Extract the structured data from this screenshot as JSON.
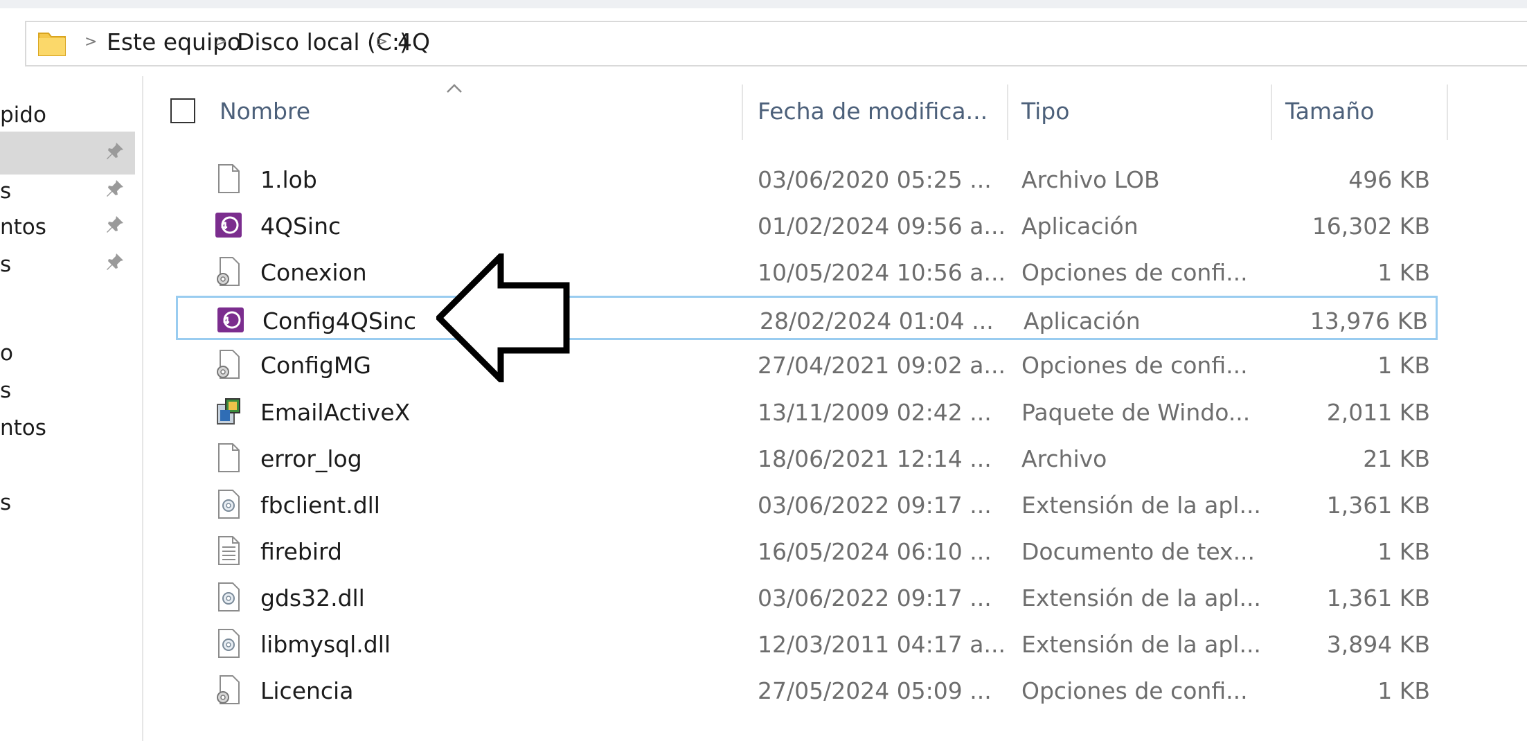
{
  "breadcrumb": [
    "Este equipo",
    "Disco local (C:)",
    "4Q"
  ],
  "nav": {
    "items": [
      {
        "label": "pido",
        "pinned": false,
        "selected": false
      },
      {
        "label": "",
        "pinned": true,
        "selected": true
      },
      {
        "label": "s",
        "pinned": true,
        "selected": false
      },
      {
        "label": "ntos",
        "pinned": true,
        "selected": false
      },
      {
        "label": "s",
        "pinned": true,
        "selected": false
      },
      {
        "label": "o",
        "pinned": false,
        "selected": false
      },
      {
        "label": "s",
        "pinned": false,
        "selected": false
      },
      {
        "label": "ntos",
        "pinned": false,
        "selected": false
      },
      {
        "label": "",
        "pinned": false,
        "selected": false
      },
      {
        "label": "s",
        "pinned": false,
        "selected": false
      }
    ]
  },
  "columns": {
    "name": "Nombre",
    "date": "Fecha de modifica...",
    "type": "Tipo",
    "size": "Tamaño"
  },
  "files": [
    {
      "name": "1.lob",
      "date": "03/06/2020 05:25 ...",
      "type": "Archivo LOB",
      "size": "496 KB",
      "icon": "blank-file-icon"
    },
    {
      "name": "4QSinc",
      "date": "01/02/2024 09:56 a...",
      "type": "Aplicación",
      "size": "16,302 KB",
      "icon": "4q-app-icon"
    },
    {
      "name": "Conexion",
      "date": "10/05/2024 10:56 a...",
      "type": "Opciones de confi...",
      "size": "1 KB",
      "icon": "config-file-icon"
    },
    {
      "name": "Config4QSinc",
      "date": "28/02/2024 01:04 ...",
      "type": "Aplicación",
      "size": "13,976 KB",
      "icon": "4q-app-icon"
    },
    {
      "name": "ConfigMG",
      "date": "27/04/2021 09:02 a...",
      "type": "Opciones de confi...",
      "size": "1 KB",
      "icon": "config-file-icon"
    },
    {
      "name": "EmailActiveX",
      "date": "13/11/2009 02:42 ...",
      "type": "Paquete de Windo...",
      "size": "2,011 KB",
      "icon": "installer-package-icon"
    },
    {
      "name": "error_log",
      "date": "18/06/2021 12:14 ...",
      "type": "Archivo",
      "size": "21 KB",
      "icon": "blank-file-icon"
    },
    {
      "name": "fbclient.dll",
      "date": "03/06/2022 09:17 ...",
      "type": "Extensión de la apl...",
      "size": "1,361 KB",
      "icon": "dll-file-icon"
    },
    {
      "name": "firebird",
      "date": "16/05/2024 06:10 ...",
      "type": "Documento de tex...",
      "size": "1 KB",
      "icon": "text-file-icon"
    },
    {
      "name": "gds32.dll",
      "date": "03/06/2022 09:17 ...",
      "type": "Extensión de la apl...",
      "size": "1,361 KB",
      "icon": "dll-file-icon"
    },
    {
      "name": "libmysql.dll",
      "date": "12/03/2011 04:17 a...",
      "type": "Extensión de la apl...",
      "size": "3,894 KB",
      "icon": "dll-file-icon"
    },
    {
      "name": "Licencia",
      "date": "27/05/2024 05:09 ...",
      "type": "Opciones de confi...",
      "size": "1 KB",
      "icon": "config-file-icon"
    }
  ],
  "selected_file": "Config4QSinc",
  "colors": {
    "app_icon": "#7b2d8e",
    "header_text": "#4c607a",
    "selection_border": "#99ccf0",
    "nav_selected": "#d9d9d9"
  }
}
